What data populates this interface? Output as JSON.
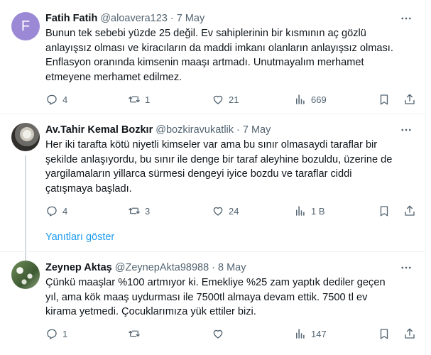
{
  "tweets": [
    {
      "avatar_letter": "F",
      "name": "Fatih Fatih",
      "handle": "@aloavera123",
      "date": "7 May",
      "text_lines": [
        "Bunun tek sebebi yüzde 25 değil. Ev sahiplerinin bir kısmının aç gözlü",
        "anlayışsız olması ve kiracıların da maddi imkanı olanların anlayışsız olması.",
        "Enflasyon oranında kimsenin maaşı artmadı. Unutmayalım merhamet",
        "etmeyene merhamet edilmez."
      ],
      "replies": "4",
      "retweets": "1",
      "likes": "21",
      "views": "669"
    },
    {
      "name": "Av.Tahir Kemal Bozkır",
      "handle": "@bozkiravukatlik",
      "date": "7 May",
      "text_lines": [
        "Her iki tarafta kötü niyetli kimseler var ama bu sınır olmasaydi taraflar bir",
        "şekilde anlaşıyordu, bu sınır ile denge bir taraf aleyhine bozuldu, üzerine de",
        "yargilamaların yillarca sürmesi dengeyi iyice bozdu ve taraflar ciddi",
        "çatışmaya başladı."
      ],
      "replies": "4",
      "retweets": "3",
      "likes": "24",
      "views": "1 B"
    },
    {
      "name": "Zeynep Aktaş",
      "handle": "@ZeynepAkta98988",
      "date": "8 May",
      "text_lines": [
        "Çünkü maaşlar %100 artmıyor ki. Emekliye %25 zam yaptık dediler geçen",
        "yıl, ama kök maaş uydurması ile 7500tl almaya devam ettik. 7500 tl ev",
        "kirama yetmedi. Çocuklarımıza yük ettiler bizi."
      ],
      "replies": "1",
      "retweets": "",
      "likes": "",
      "views": "147"
    }
  ],
  "show_replies_label": "Yanıtları göster",
  "colors": {
    "accent": "#1d9bf0",
    "muted": "#536471",
    "text": "#0f1419"
  }
}
